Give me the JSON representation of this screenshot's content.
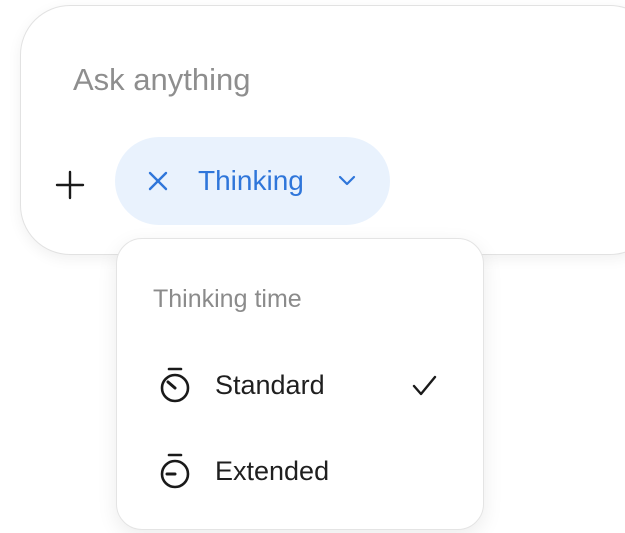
{
  "composer": {
    "placeholder": "Ask anything"
  },
  "toolbar": {
    "add_icon": "plus-icon",
    "mode_pill": {
      "label": "Thinking",
      "close_icon": "close-icon",
      "chevron_icon": "chevron-down-icon"
    }
  },
  "thinking_menu": {
    "header": "Thinking time",
    "items": [
      {
        "label": "Standard",
        "icon": "timer-icon",
        "selected": true
      },
      {
        "label": "Extended",
        "icon": "timer-icon",
        "selected": false
      }
    ]
  },
  "colors": {
    "accent": "#2f76da",
    "pill_background": "#e9f2fd",
    "placeholder": "#8e8e8e"
  }
}
